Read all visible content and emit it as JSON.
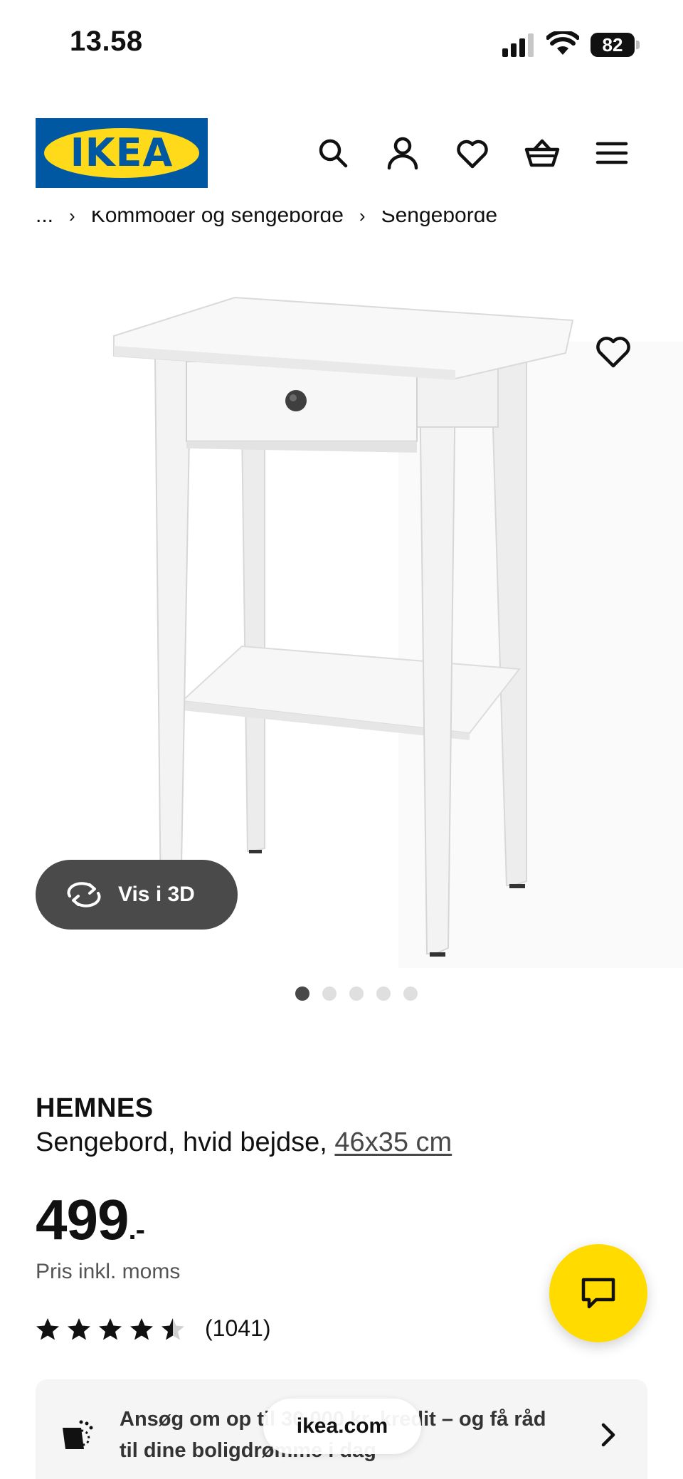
{
  "status_bar": {
    "time": "13.58",
    "battery_level": "82"
  },
  "header": {
    "logo_text": "IKEA",
    "icons": [
      "search-icon",
      "account-icon",
      "heart-icon",
      "cart-icon",
      "menu-icon"
    ]
  },
  "breadcrumb": {
    "ellipsis": "...",
    "items": [
      "Kommoder og sengeborde",
      "Sengeborde"
    ],
    "separator": "›"
  },
  "gallery": {
    "view_3d_label": "Vis i 3D",
    "total_images": 5,
    "active_index": 0
  },
  "product": {
    "name": "HEMNES",
    "description": "Sengebord, hvid bejdse,",
    "size": "46x35 cm",
    "price": "499",
    "price_suffix": ".-",
    "price_note": "Pris inkl. moms",
    "rating": 4.5,
    "rating_count": "(1041)"
  },
  "credit_banner": {
    "text": "Ansøg om op til 30.000 kr. kredit – og få råd til dine boligdrømme i dag"
  },
  "browser": {
    "url": "ikea.com"
  },
  "colors": {
    "ikea_blue": "#0058a3",
    "ikea_yellow": "#ffda1a",
    "chat_yellow": "#ffdb00"
  }
}
